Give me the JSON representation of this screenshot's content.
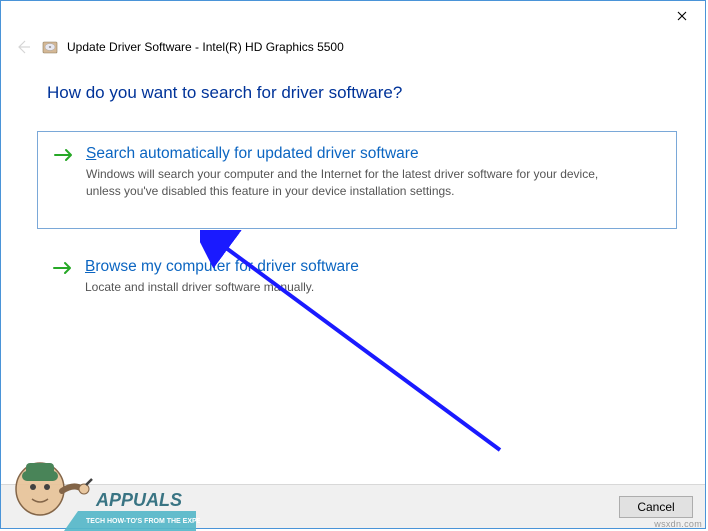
{
  "dialog": {
    "title": "Update Driver Software - Intel(R) HD Graphics 5500",
    "question": "How do you want to search for driver software?"
  },
  "options": {
    "auto": {
      "title_prefix": "S",
      "title_rest": "earch automatically for updated driver software",
      "desc_line1": "Windows will search your computer and the Internet for the latest driver software for your device,",
      "desc_line2": "unless you've disabled this feature in your device installation settings."
    },
    "browse": {
      "title_prefix": "B",
      "title_rest": "rowse my computer for driver software",
      "desc": "Locate and install driver software manually."
    }
  },
  "buttons": {
    "cancel": "Cancel"
  },
  "watermark": {
    "brand": "APPUALS",
    "tag": "TECH HOW-TO'S FROM THE EXPERTS!",
    "url": "wsxdn.com"
  }
}
